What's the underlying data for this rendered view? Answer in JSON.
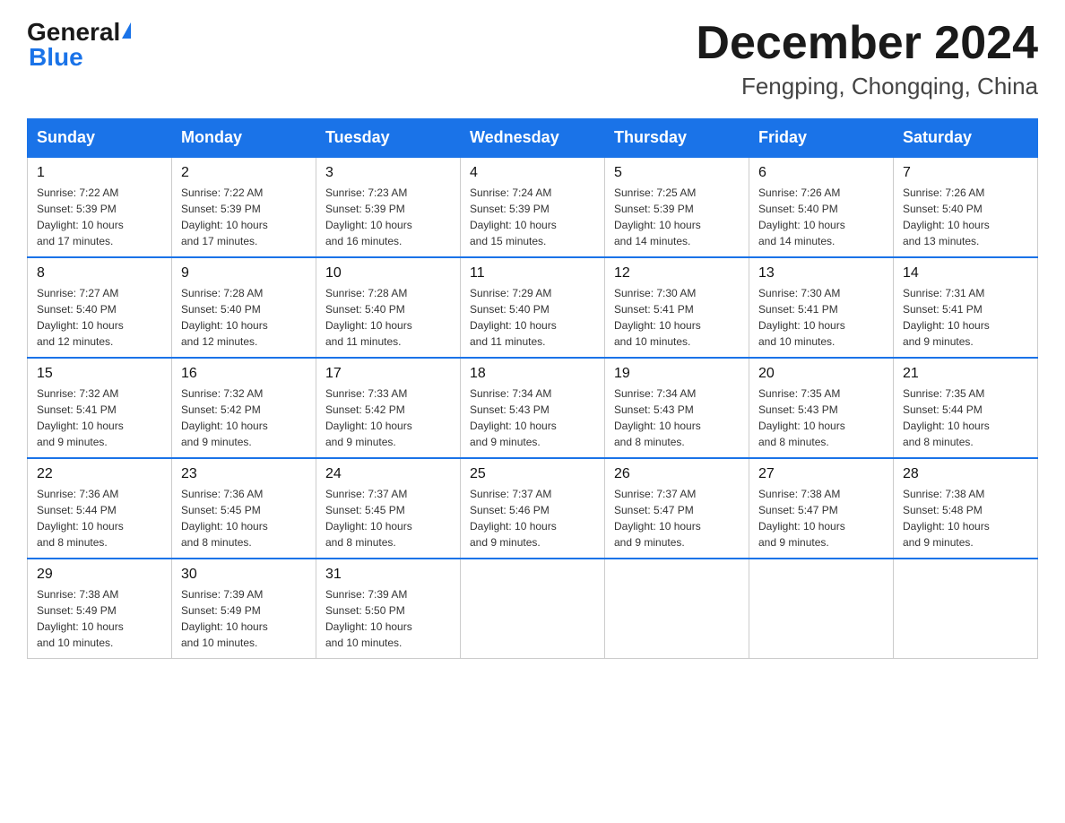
{
  "header": {
    "logo_general": "General",
    "logo_blue": "Blue",
    "month_title": "December 2024",
    "location": "Fengping, Chongqing, China"
  },
  "days_of_week": [
    "Sunday",
    "Monday",
    "Tuesday",
    "Wednesday",
    "Thursday",
    "Friday",
    "Saturday"
  ],
  "weeks": [
    [
      {
        "day": "1",
        "sunrise": "7:22 AM",
        "sunset": "5:39 PM",
        "daylight": "10 hours and 17 minutes."
      },
      {
        "day": "2",
        "sunrise": "7:22 AM",
        "sunset": "5:39 PM",
        "daylight": "10 hours and 17 minutes."
      },
      {
        "day": "3",
        "sunrise": "7:23 AM",
        "sunset": "5:39 PM",
        "daylight": "10 hours and 16 minutes."
      },
      {
        "day": "4",
        "sunrise": "7:24 AM",
        "sunset": "5:39 PM",
        "daylight": "10 hours and 15 minutes."
      },
      {
        "day": "5",
        "sunrise": "7:25 AM",
        "sunset": "5:39 PM",
        "daylight": "10 hours and 14 minutes."
      },
      {
        "day": "6",
        "sunrise": "7:26 AM",
        "sunset": "5:40 PM",
        "daylight": "10 hours and 14 minutes."
      },
      {
        "day": "7",
        "sunrise": "7:26 AM",
        "sunset": "5:40 PM",
        "daylight": "10 hours and 13 minutes."
      }
    ],
    [
      {
        "day": "8",
        "sunrise": "7:27 AM",
        "sunset": "5:40 PM",
        "daylight": "10 hours and 12 minutes."
      },
      {
        "day": "9",
        "sunrise": "7:28 AM",
        "sunset": "5:40 PM",
        "daylight": "10 hours and 12 minutes."
      },
      {
        "day": "10",
        "sunrise": "7:28 AM",
        "sunset": "5:40 PM",
        "daylight": "10 hours and 11 minutes."
      },
      {
        "day": "11",
        "sunrise": "7:29 AM",
        "sunset": "5:40 PM",
        "daylight": "10 hours and 11 minutes."
      },
      {
        "day": "12",
        "sunrise": "7:30 AM",
        "sunset": "5:41 PM",
        "daylight": "10 hours and 10 minutes."
      },
      {
        "day": "13",
        "sunrise": "7:30 AM",
        "sunset": "5:41 PM",
        "daylight": "10 hours and 10 minutes."
      },
      {
        "day": "14",
        "sunrise": "7:31 AM",
        "sunset": "5:41 PM",
        "daylight": "10 hours and 9 minutes."
      }
    ],
    [
      {
        "day": "15",
        "sunrise": "7:32 AM",
        "sunset": "5:41 PM",
        "daylight": "10 hours and 9 minutes."
      },
      {
        "day": "16",
        "sunrise": "7:32 AM",
        "sunset": "5:42 PM",
        "daylight": "10 hours and 9 minutes."
      },
      {
        "day": "17",
        "sunrise": "7:33 AM",
        "sunset": "5:42 PM",
        "daylight": "10 hours and 9 minutes."
      },
      {
        "day": "18",
        "sunrise": "7:34 AM",
        "sunset": "5:43 PM",
        "daylight": "10 hours and 9 minutes."
      },
      {
        "day": "19",
        "sunrise": "7:34 AM",
        "sunset": "5:43 PM",
        "daylight": "10 hours and 8 minutes."
      },
      {
        "day": "20",
        "sunrise": "7:35 AM",
        "sunset": "5:43 PM",
        "daylight": "10 hours and 8 minutes."
      },
      {
        "day": "21",
        "sunrise": "7:35 AM",
        "sunset": "5:44 PM",
        "daylight": "10 hours and 8 minutes."
      }
    ],
    [
      {
        "day": "22",
        "sunrise": "7:36 AM",
        "sunset": "5:44 PM",
        "daylight": "10 hours and 8 minutes."
      },
      {
        "day": "23",
        "sunrise": "7:36 AM",
        "sunset": "5:45 PM",
        "daylight": "10 hours and 8 minutes."
      },
      {
        "day": "24",
        "sunrise": "7:37 AM",
        "sunset": "5:45 PM",
        "daylight": "10 hours and 8 minutes."
      },
      {
        "day": "25",
        "sunrise": "7:37 AM",
        "sunset": "5:46 PM",
        "daylight": "10 hours and 9 minutes."
      },
      {
        "day": "26",
        "sunrise": "7:37 AM",
        "sunset": "5:47 PM",
        "daylight": "10 hours and 9 minutes."
      },
      {
        "day": "27",
        "sunrise": "7:38 AM",
        "sunset": "5:47 PM",
        "daylight": "10 hours and 9 minutes."
      },
      {
        "day": "28",
        "sunrise": "7:38 AM",
        "sunset": "5:48 PM",
        "daylight": "10 hours and 9 minutes."
      }
    ],
    [
      {
        "day": "29",
        "sunrise": "7:38 AM",
        "sunset": "5:49 PM",
        "daylight": "10 hours and 10 minutes."
      },
      {
        "day": "30",
        "sunrise": "7:39 AM",
        "sunset": "5:49 PM",
        "daylight": "10 hours and 10 minutes."
      },
      {
        "day": "31",
        "sunrise": "7:39 AM",
        "sunset": "5:50 PM",
        "daylight": "10 hours and 10 minutes."
      },
      null,
      null,
      null,
      null
    ]
  ],
  "labels": {
    "sunrise": "Sunrise:",
    "sunset": "Sunset:",
    "daylight": "Daylight:"
  }
}
